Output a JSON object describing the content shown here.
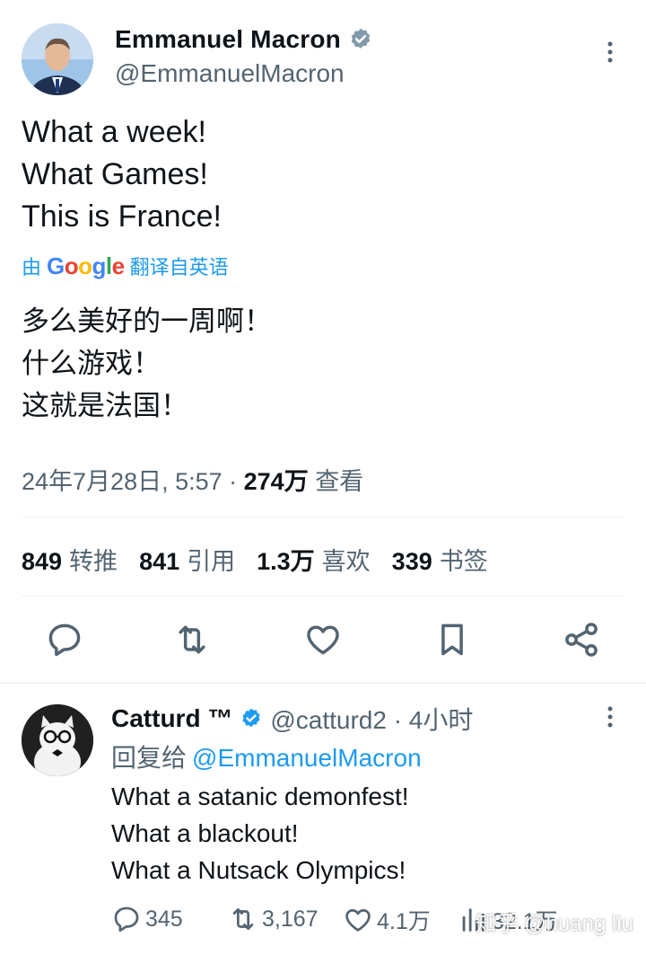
{
  "main_tweet": {
    "author_name": "Emmanuel Macron",
    "author_handle": "@EmmanuelMacron",
    "lines": [
      "What a week!",
      "What Games!",
      "This is France!"
    ],
    "translate": {
      "prefix": "由",
      "brand": "Google",
      "suffix": "翻译自英语"
    },
    "translated_lines": [
      "多么美好的一周啊！",
      "什么游戏！",
      "这就是法国！"
    ],
    "timestamp": "24年7月28日, 5:57 · ",
    "views": "274万",
    "views_label": " 查看",
    "stats": [
      {
        "value": "849",
        "label": "转推"
      },
      {
        "value": "841",
        "label": "引用"
      },
      {
        "value": "1.3万",
        "label": "喜欢"
      },
      {
        "value": "339",
        "label": "书签"
      }
    ]
  },
  "reply": {
    "author_name": "Catturd ™",
    "author_handle": "@catturd2 · 4小时",
    "reply_prefix": "回复给",
    "reply_mention": "@EmmanuelMacron",
    "lines": [
      "What a satanic demonfest!",
      "What a blackout!",
      "What a Nutsack Olympics!"
    ],
    "actions": {
      "replies": "345",
      "retweets": "3,167",
      "likes": "4.1万",
      "views": "32.1万"
    }
  },
  "watermark": "知乎 @huang liu",
  "colors": {
    "accent": "#1d9bf0",
    "text": "#0f1419",
    "secondary": "#536471",
    "divider": "#eff3f4"
  }
}
